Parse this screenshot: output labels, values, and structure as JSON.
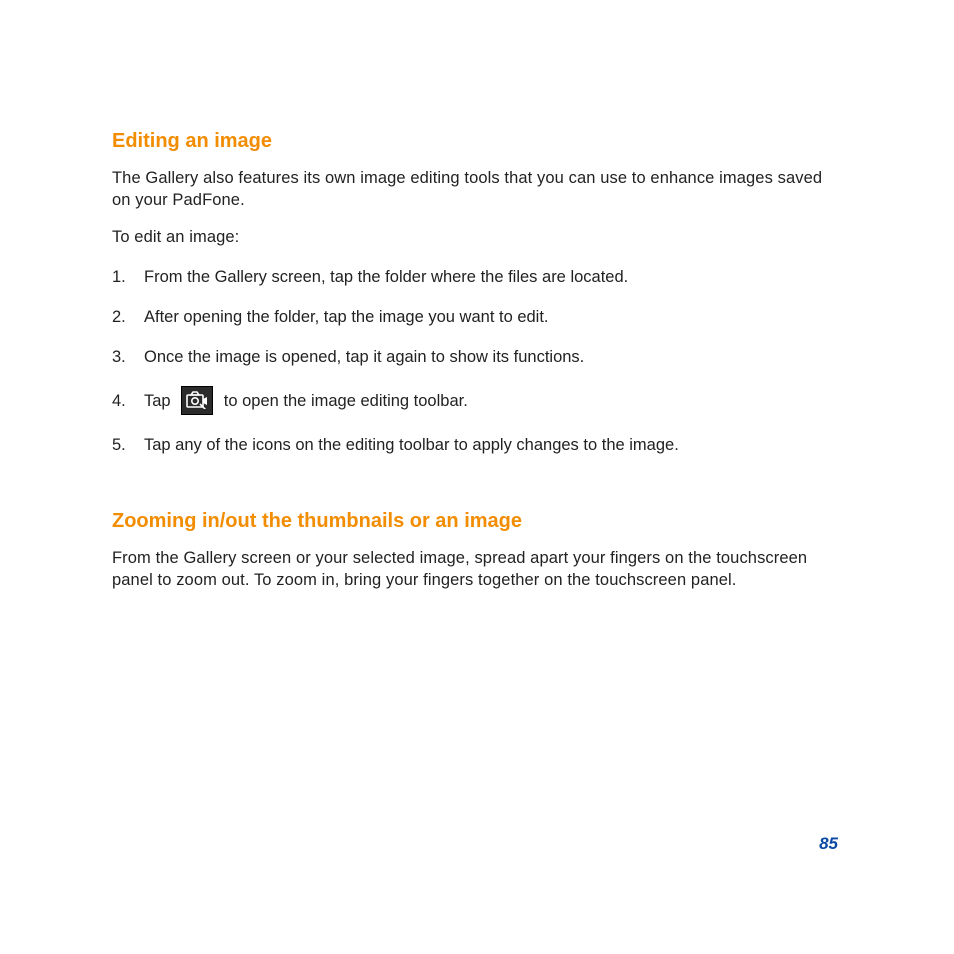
{
  "section1": {
    "heading": "Editing an image",
    "paragraph": "The Gallery also features its own image editing tools that you can use to enhance images saved on your PadFone.",
    "lead": "To edit an image:",
    "steps": [
      {
        "num": "1.",
        "text": "From the Gallery screen, tap the folder where the files are located."
      },
      {
        "num": "2.",
        "text": "After opening the folder, tap the image you want to edit."
      },
      {
        "num": "3.",
        "text": "Once the image is opened, tap it again to show its functions."
      },
      {
        "num": "4.",
        "pre": "Tap ",
        "post": " to open the image editing toolbar."
      },
      {
        "num": "5.",
        "text": "Tap any of the icons on the editing toolbar to apply changes to the image."
      }
    ]
  },
  "section2": {
    "heading": "Zooming in/out the thumbnails or an image",
    "paragraph": "From the Gallery screen or your selected image,  spread apart your fingers on the touchscreen panel to zoom out. To zoom in, bring your fingers together on the touchscreen panel."
  },
  "page_number": "85"
}
